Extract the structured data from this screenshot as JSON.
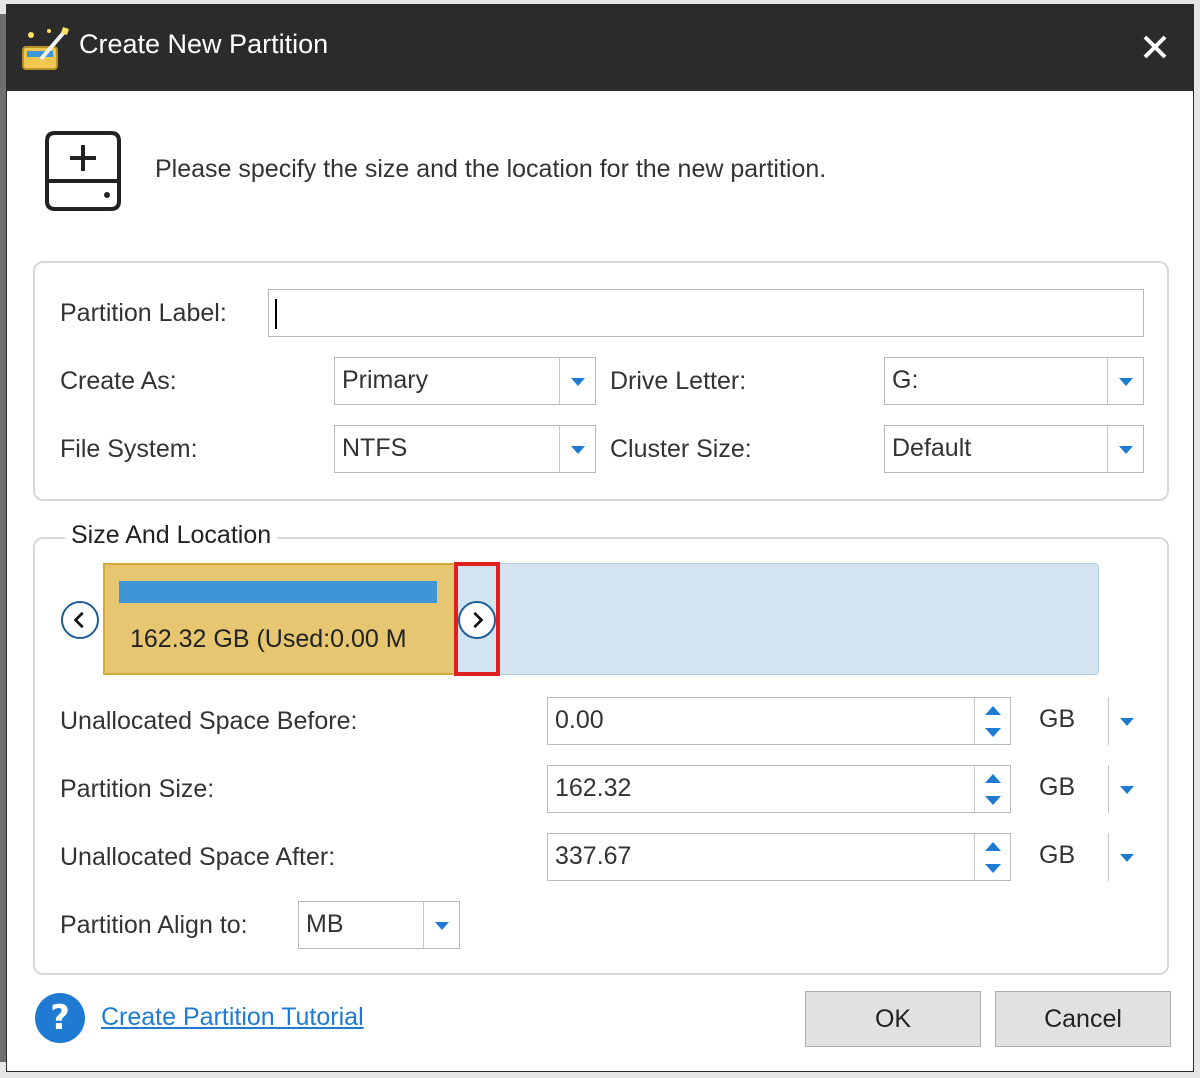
{
  "dialog": {
    "title": "Create New Partition",
    "header_text": "Please specify the size and the location for the new partition."
  },
  "partition": {
    "label_caption": "Partition Label:",
    "label_value": "",
    "create_as_caption": "Create As:",
    "create_as_value": "Primary",
    "drive_letter_caption": "Drive Letter:",
    "drive_letter_value": "G:",
    "file_system_caption": "File System:",
    "file_system_value": "NTFS",
    "cluster_size_caption": "Cluster Size:",
    "cluster_size_value": "Default"
  },
  "size_location": {
    "legend": "Size And Location",
    "block_text": "162.32 GB (Used:0.00 M",
    "unalloc_before_caption": "Unallocated Space Before:",
    "unalloc_before_value": "0.00",
    "unalloc_before_unit": "GB",
    "partition_size_caption": "Partition Size:",
    "partition_size_value": "162.32",
    "partition_size_unit": "GB",
    "unalloc_after_caption": "Unallocated Space After:",
    "unalloc_after_value": "337.67",
    "unalloc_after_unit": "GB",
    "align_caption": "Partition Align to:",
    "align_value": "MB"
  },
  "footer": {
    "tutorial_link": "Create Partition Tutorial",
    "ok_label": "OK",
    "cancel_label": "Cancel"
  },
  "icons": {
    "app": "partition-wizard-icon",
    "close": "close-icon",
    "header": "add-disk-icon",
    "help": "help-icon",
    "left_arrow": "chevron-left-icon",
    "right_arrow": "chevron-right-icon"
  },
  "colors": {
    "titlebar": "#2b2b2b",
    "partition_block": "#e6c670",
    "usage_bar": "#3d95d6",
    "unallocated": "#d3e4f0",
    "highlight": "#e02020",
    "accent": "#1f7ad1"
  }
}
